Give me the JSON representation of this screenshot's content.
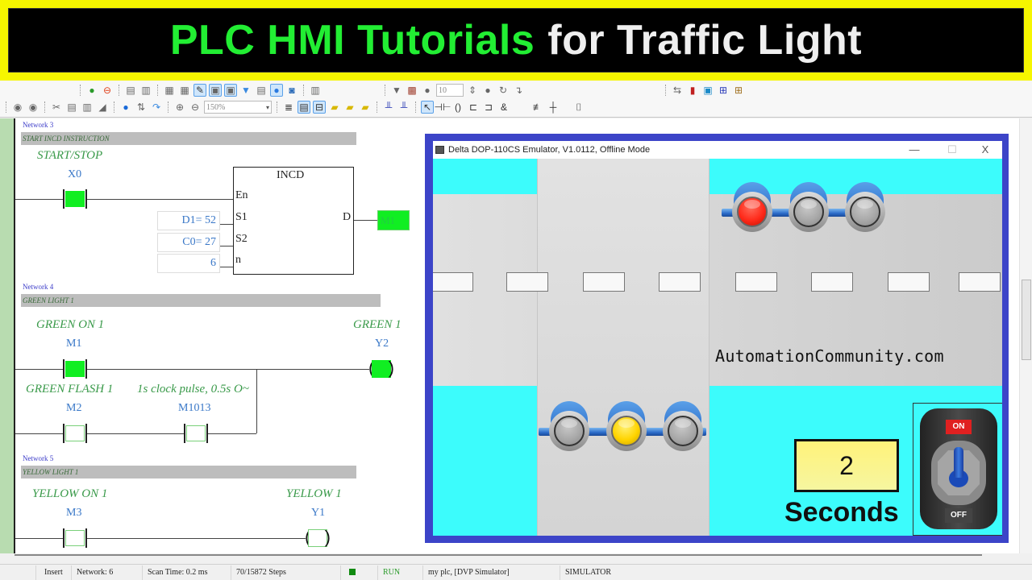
{
  "banner": {
    "title_green": "PLC HMI Tutorials",
    "title_white": "for Traffic Light",
    "colors": {
      "background": "#f6f600",
      "green": "#22ee33",
      "white": "#efefef"
    }
  },
  "toolbar": {
    "zoom_level": "150%",
    "step_value": "10",
    "row1_icons": [
      "online-icon",
      "stop-icon",
      "upload-icon",
      "download-icon",
      "compare-icon",
      "compare2-icon",
      "edit-mode-icon",
      "view1-icon",
      "view2-icon",
      "monitor-icon",
      "device-icon",
      "bulb-icon",
      "comm-icon",
      "network-icon"
    ],
    "row1b_icons": [
      "breakpoint-icon",
      "camera-icon",
      "run-icon",
      "stop-step-icon",
      "refresh-icon",
      "step-icon"
    ],
    "row1c_icons": [
      "transfer-icon",
      "thermometer-icon",
      "display-icon",
      "io-blue-icon",
      "io-brown-icon"
    ],
    "row2_icons": [
      "back-icon",
      "forward-icon",
      "cut-icon",
      "copy-icon",
      "paste-icon",
      "eraser-icon",
      "find-icon",
      "sort-icon",
      "replace-icon",
      "zoom-in-icon",
      "zoom-out-icon"
    ],
    "row2b_icons": [
      "comment-icon",
      "window-icon",
      "split-icon",
      "folder-icon",
      "folder-open-icon",
      "folder-up-icon",
      "insert-row-icon",
      "delete-row-icon",
      "pointer-icon",
      "contact-icon",
      "coil-icon",
      "function-icon",
      "jump-icon",
      "and-icon",
      "hline-icon",
      "vline-icon",
      "bracket-icon"
    ]
  },
  "ladder": {
    "networks": [
      {
        "title": "Network 3",
        "comment": "START INCD INSTRUCTION",
        "contact_comment": "START/STOP",
        "contact_device": "X0",
        "contact_on": true,
        "block": {
          "name": "INCD",
          "pins": {
            "en": "En",
            "s1": "S1",
            "s2": "S2",
            "n": "n",
            "d": "D"
          },
          "params": {
            "s1": "D1= 52",
            "s2": "C0= 27",
            "n": "6"
          },
          "output_device": "M1"
        }
      },
      {
        "title": "Network 4",
        "comment": "GREEN LIGHT 1",
        "rung_contacts": [
          {
            "comment": "GREEN ON 1",
            "device": "M1",
            "on": true
          },
          {
            "comment": "GREEN FLASH 1",
            "device": "M2",
            "on": false
          },
          {
            "comment": "1s clock pulse, 0.5s O~",
            "device": "M1013",
            "on": false
          }
        ],
        "coil": {
          "comment": "GREEN 1",
          "device": "Y2",
          "on": true
        }
      },
      {
        "title": "Network 5",
        "comment": "YELLOW LIGHT 1",
        "rung_contacts": [
          {
            "comment": "YELLOW ON 1",
            "device": "M3",
            "on": false
          }
        ],
        "coil": {
          "comment": "YELLOW 1",
          "device": "Y1",
          "on": false
        }
      }
    ]
  },
  "hmi": {
    "window_title": "Delta DOP-110CS Emulator, V1.0112, Offline Mode",
    "controls": {
      "minimize": "—",
      "maximize": "☐",
      "close": "X"
    },
    "watermark": "AutomationCommunity.com",
    "timer_value": "2",
    "timer_unit": "Seconds",
    "switch": {
      "on_label": "ON",
      "off_label": "OFF",
      "state": "on"
    },
    "traffic_light_1": {
      "red": true,
      "yellow": false,
      "green": false
    },
    "traffic_light_2": {
      "left": false,
      "middle_yellow": true,
      "right": false
    },
    "colors": {
      "frame": "#3c44c8",
      "cyan": "#3cfcfc",
      "red": "#ff2a1a",
      "yellow": "#ffd400",
      "off": "#a8a8a8"
    }
  },
  "statusbar": {
    "mode": "Insert",
    "network": "Network: 6",
    "scan_time": "Scan Time: 0.2 ms",
    "steps": "70/15872 Steps",
    "run_state": "RUN",
    "plc": "my plc, [DVP Simulator]",
    "connection": "SIMULATOR"
  }
}
